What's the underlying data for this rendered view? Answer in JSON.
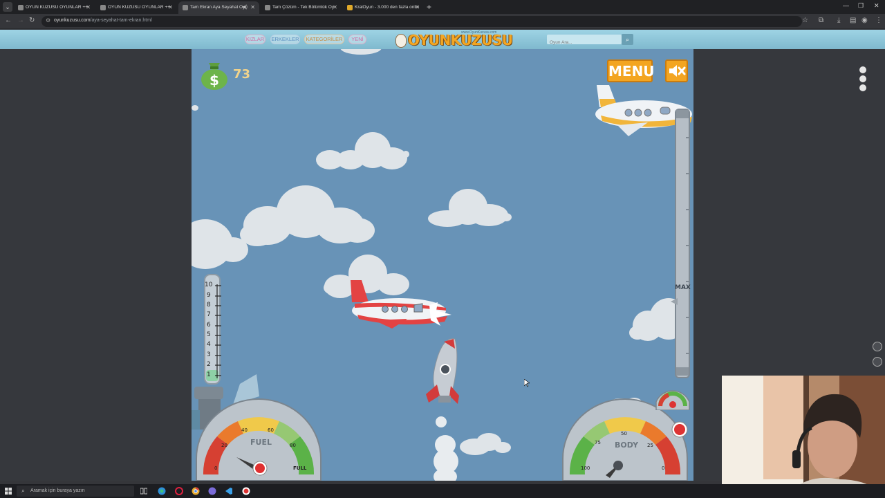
{
  "browser": {
    "tabs": [
      {
        "title": "OYUN KUZUSU OYUNLAR ++",
        "active": false
      },
      {
        "title": "OYUN KUZUSU OYUNLAR ++",
        "active": false
      },
      {
        "title": "Tam Ekran Aya Seyahat Oy",
        "active": true
      },
      {
        "title": "Tam Çözüm - Tek Bölümlük Oy",
        "active": false
      },
      {
        "title": "KralOyun - 3.000 den fazla onlin",
        "active": false
      }
    ],
    "url_host": "oyunkuzusu.com",
    "url_path": "/aya-seyahat-tam-ekran.html"
  },
  "site": {
    "nav": [
      "KIZLAR",
      "ERKEKLER",
      "KATEGORİLER",
      "YENİ"
    ],
    "logo_text": "OYUNKUZUSU",
    "logo_small": "www.OyunKuzusu.com",
    "search_placeholder": "Oyun Ara..."
  },
  "game": {
    "money": "73",
    "menu_label": "MENU",
    "altitude_max_label": "MAX",
    "fuel_scale": [
      "10",
      "9",
      "8",
      "7",
      "6",
      "5",
      "4",
      "3",
      "2",
      "1"
    ],
    "fuel_gauge": {
      "label": "FUEL",
      "ticks": [
        "0",
        "20",
        "40",
        "60",
        "80",
        "FULL"
      ]
    },
    "body_gauge": {
      "label": "BODY",
      "ticks": [
        "100",
        "75",
        "50",
        "25",
        "0"
      ]
    }
  },
  "taskbar": {
    "search_placeholder": "Aramak için buraya yazın"
  },
  "colors": {
    "sky": "#6893b7",
    "accent_orange": "#f3a521",
    "header_blue": "#9ed3e4"
  }
}
